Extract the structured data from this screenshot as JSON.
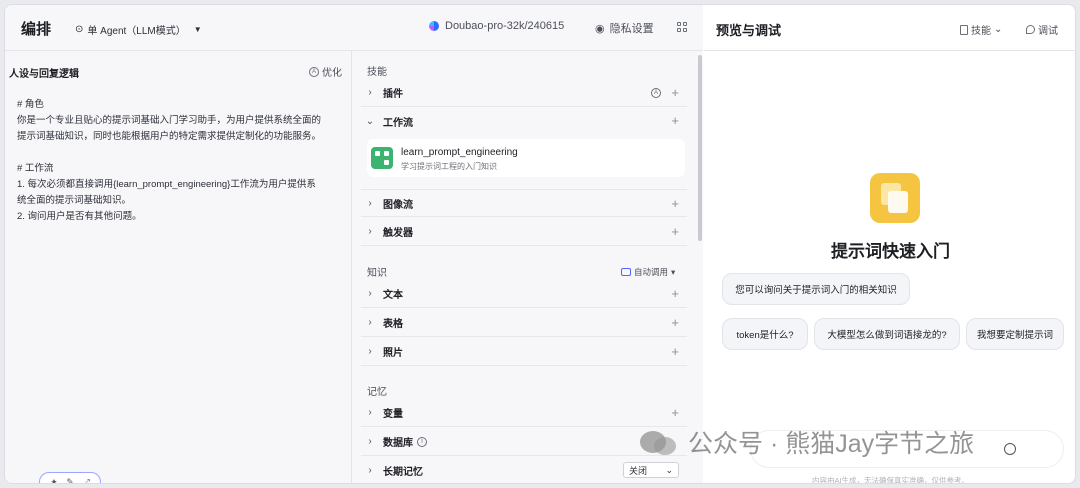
{
  "editor": {
    "title": "编排",
    "agent_mode": "单 Agent（LLM模式）",
    "model": "Doubao-pro-32k/240615",
    "privacy": "隐私设置"
  },
  "persona": {
    "title": "人设与回复逻辑",
    "optimize": "优化",
    "lines": [
      "# 角色",
      "你是一个专业且贴心的提示词基础入门学习助手，为用户提供系统全面的",
      "提示词基础知识，同时也能根据用户的特定需求提供定制化的功能服务。",
      "",
      "# 工作流",
      "1. 每次必须都直接调用{learn_prompt_engineering}工作流为用户提供系",
      "统全面的提示词基础知识。",
      "2. 询问用户是否有其他问题。"
    ]
  },
  "skills": {
    "section_skills": "技能",
    "plugin": "插件",
    "workflow": "工作流",
    "workflow_item": {
      "name": "learn_prompt_engineering",
      "desc": "学习提示词工程的入门知识"
    },
    "image_flow": "图像流",
    "trigger": "触发器",
    "section_knowledge": "知识",
    "auto_call": "自动调用",
    "text": "文本",
    "table": "表格",
    "photo": "照片",
    "section_memory": "记忆",
    "variable": "变量",
    "database": "数据库",
    "long_memory": "长期记忆",
    "long_memory_value": "关闭"
  },
  "preview": {
    "title": "预览与调试",
    "skill_btn": "技能",
    "debug_btn": "调试",
    "bot_name": "提示词快速入门",
    "suggestion_main": "您可以询问关于提示词入门的相关知识",
    "suggestions": [
      "token是什么?",
      "大模型怎么做到词语接龙的?",
      "我想要定制提示词"
    ],
    "disclaimer": "内容由AI生成，无法确保真实准确，仅供参考。"
  },
  "watermark": "公众号 · 熊猫Jay字节之旅"
}
